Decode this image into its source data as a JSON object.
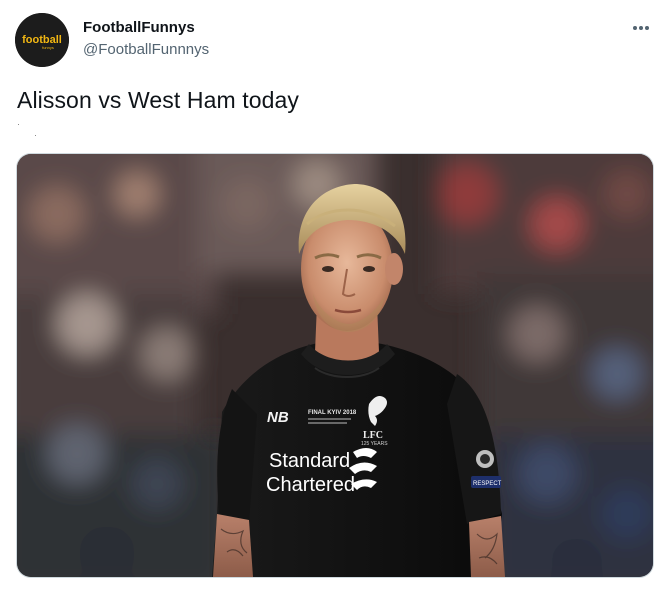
{
  "author": {
    "display_name": "FootballFunnys",
    "handle": "@FootballFunnnys",
    "avatar_logo_text": "football",
    "avatar_logo_subtext": "funnys"
  },
  "menu": {
    "icon": "more-horizontal-icon"
  },
  "tweet": {
    "text": "Alisson vs West Ham today"
  },
  "media": {
    "image": "goalkeeper-photo",
    "shirt_sponsor_line1": "Standard",
    "shirt_sponsor_line2": "Chartered",
    "shirt_badge_text": "LFC",
    "shirt_badge_years": "125 YEARS",
    "shirt_final_text": "FINAL KYIV 2018",
    "sleeve_text": "RESPECT"
  },
  "colors": {
    "text_primary": "#0f1419",
    "text_secondary": "#536471",
    "shirt": "#121212",
    "avatar_logo": "#f2b713"
  }
}
